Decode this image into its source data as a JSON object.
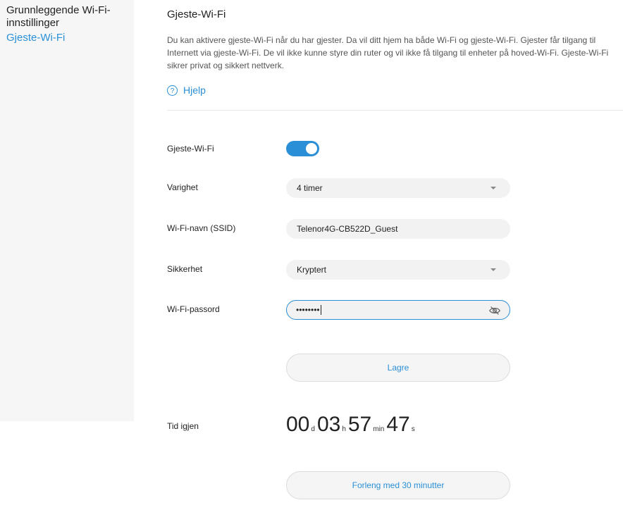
{
  "sidebar": {
    "items": [
      {
        "label": "Grunnleggende Wi-Fi-innstillinger"
      },
      {
        "label": "Gjeste-Wi-Fi"
      }
    ]
  },
  "main": {
    "title": "Gjeste-Wi-Fi",
    "description": "Du kan aktivere gjeste-Wi-Fi når du har gjester. Da vil ditt hjem ha både Wi-Fi og gjeste-Wi-Fi. Gjester får tilgang til Internett via gjeste-Wi-Fi. De vil ikke kunne styre din ruter og vil ikke få tilgang til enheter på hoved-Wi-Fi. Gjeste-Wi-Fi sikrer privat og sikkert nettverk.",
    "help_label": "Hjelp",
    "help_icon": "?"
  },
  "form": {
    "guest_wifi_label": "Gjeste-Wi-Fi",
    "guest_wifi_enabled": true,
    "duration_label": "Varighet",
    "duration_value": "4 timer",
    "ssid_label": "Wi-Fi-navn (SSID)",
    "ssid_value": "Telenor4G-CB522D_Guest",
    "security_label": "Sikkerhet",
    "security_value": "Kryptert",
    "password_label": "Wi-Fi-passord",
    "password_mask": "••••••••",
    "save_label": "Lagre"
  },
  "timer": {
    "label": "Tid igjen",
    "days": "00",
    "days_unit": "d",
    "hours": "03",
    "hours_unit": "h",
    "minutes": "57",
    "minutes_unit": "min",
    "seconds": "47",
    "seconds_unit": "s",
    "extend_label": "Forleng med 30 minutter"
  },
  "colors": {
    "accent": "#2a8fd6",
    "sidebar_bg": "#f6f6f6",
    "field_bg": "#f2f2f2"
  }
}
